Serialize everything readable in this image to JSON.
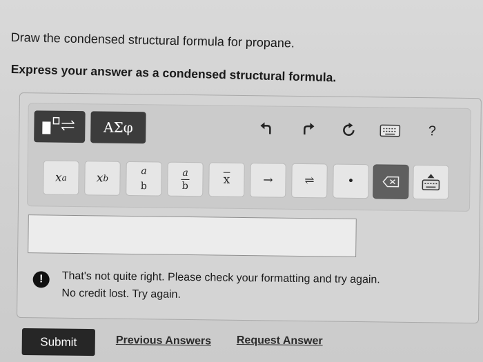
{
  "question": {
    "prompt": "Draw the condensed structural formula for propane.",
    "instruction": "Express your answer as a condensed structural formula."
  },
  "toolbar": {
    "greek_label": "ΑΣφ",
    "help_label": "?",
    "keys": [
      {
        "name": "superscript",
        "base": "x",
        "sup": "a"
      },
      {
        "name": "subscript",
        "base": "x",
        "sub": "b"
      },
      {
        "name": "fraction",
        "num": "a",
        "den": "b"
      },
      {
        "name": "overbar-fraction",
        "num": "a",
        "den": "b"
      },
      {
        "name": "overline",
        "label": "x"
      },
      {
        "name": "arrow",
        "label": "→"
      },
      {
        "name": "equilibrium",
        "label": "⇌"
      },
      {
        "name": "dot",
        "label": "•"
      },
      {
        "name": "delete",
        "label": "⌫"
      },
      {
        "name": "keyboard",
        "label": "⌨"
      }
    ]
  },
  "answer": {
    "value": ""
  },
  "feedback": {
    "line1": "That's not quite right. Please check your formatting and try again.",
    "line2": "No credit lost. Try again."
  },
  "actions": {
    "submit": "Submit",
    "previous": "Previous Answers",
    "request": "Request Answer"
  }
}
